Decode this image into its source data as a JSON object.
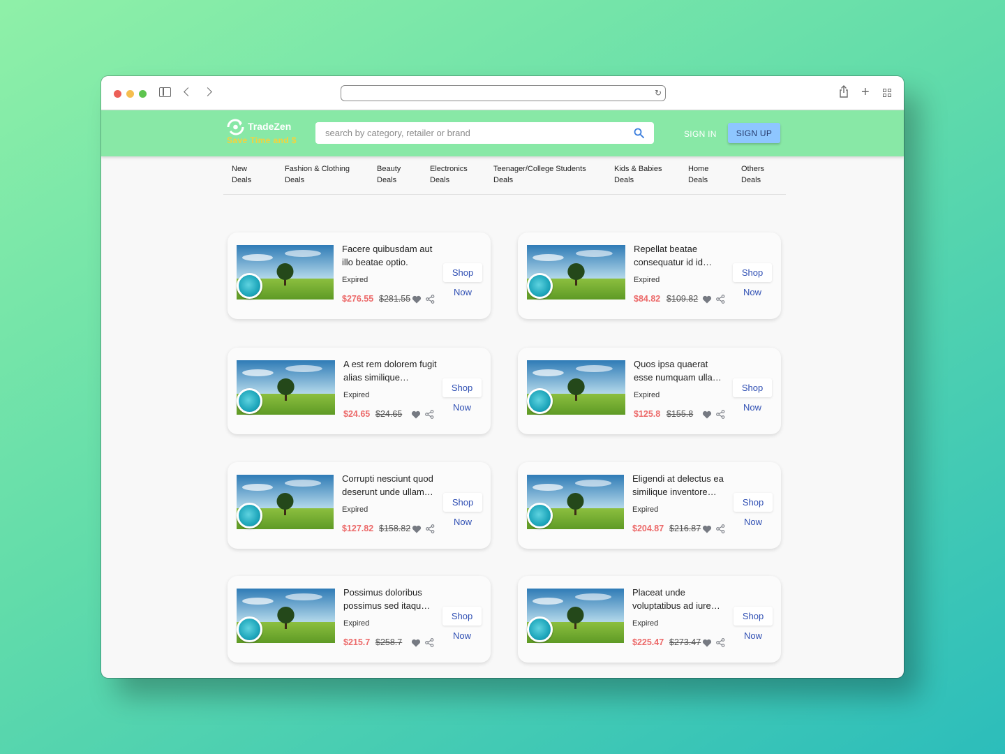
{
  "header": {
    "brand_name": "TradeZen",
    "tagline": "Save Time and $",
    "search_placeholder": "search by category, retailer or brand",
    "signin_label": "SIGN IN",
    "signup_label": "SIGN UP",
    "brand_color": "#88e8a6",
    "tagline_color": "#f6d33a"
  },
  "nav": [
    {
      "line1": "New",
      "line2": "Deals"
    },
    {
      "line1": "Fashion & Clothing",
      "line2": "Deals"
    },
    {
      "line1": "Beauty",
      "line2": "Deals"
    },
    {
      "line1": "Electronics",
      "line2": "Deals"
    },
    {
      "line1": "Teenager/College Students",
      "line2": "Deals"
    },
    {
      "line1": "Kids & Babies",
      "line2": "Deals"
    },
    {
      "line1": "Home",
      "line2": "Deals"
    },
    {
      "line1": "Others",
      "line2": "Deals"
    }
  ],
  "deals": [
    {
      "title": "Facere quibusdam aut illo beatae optio.",
      "status": "Expired",
      "price": "$276.55",
      "old_price": "$281.55",
      "shop_label": "Shop",
      "now_label": "Now"
    },
    {
      "title": "Repellat beatae consequatur id id…",
      "status": "Expired",
      "price": "$84.82",
      "old_price": "$109.82",
      "shop_label": "Shop",
      "now_label": "Now"
    },
    {
      "title": "A est rem dolorem fugit alias similique…",
      "status": "Expired",
      "price": "$24.65",
      "old_price": "$24.65",
      "shop_label": "Shop",
      "now_label": "Now"
    },
    {
      "title": "Quos ipsa quaerat esse numquam ulla…",
      "status": "Expired",
      "price": "$125.8",
      "old_price": "$155.8",
      "shop_label": "Shop",
      "now_label": "Now"
    },
    {
      "title": "Corrupti nesciunt quod deserunt unde ullam…",
      "status": "Expired",
      "price": "$127.82",
      "old_price": "$158.82",
      "shop_label": "Shop",
      "now_label": "Now"
    },
    {
      "title": "Eligendi at delectus ea similique inventore…",
      "status": "Expired",
      "price": "$204.87",
      "old_price": "$216.87",
      "shop_label": "Shop",
      "now_label": "Now"
    },
    {
      "title": "Possimus doloribus possimus sed itaqu…",
      "status": "Expired",
      "price": "$215.7",
      "old_price": "$258.7",
      "shop_label": "Shop",
      "now_label": "Now"
    },
    {
      "title": "Placeat unde voluptatibus ad iure…",
      "status": "Expired",
      "price": "$225.47",
      "old_price": "$273.47",
      "shop_label": "Shop",
      "now_label": "Now"
    }
  ],
  "colors": {
    "sale_price": "#ec6a6a",
    "shop_button_text": "#2f4fb3",
    "signup_button": "#8ec6ff"
  },
  "icons": [
    "sidebar-icon",
    "chevron-left-icon",
    "chevron-right-icon",
    "reload-icon",
    "share-icon",
    "plus-icon",
    "tabs-icon",
    "search-icon",
    "heart-icon",
    "share-node-icon"
  ]
}
